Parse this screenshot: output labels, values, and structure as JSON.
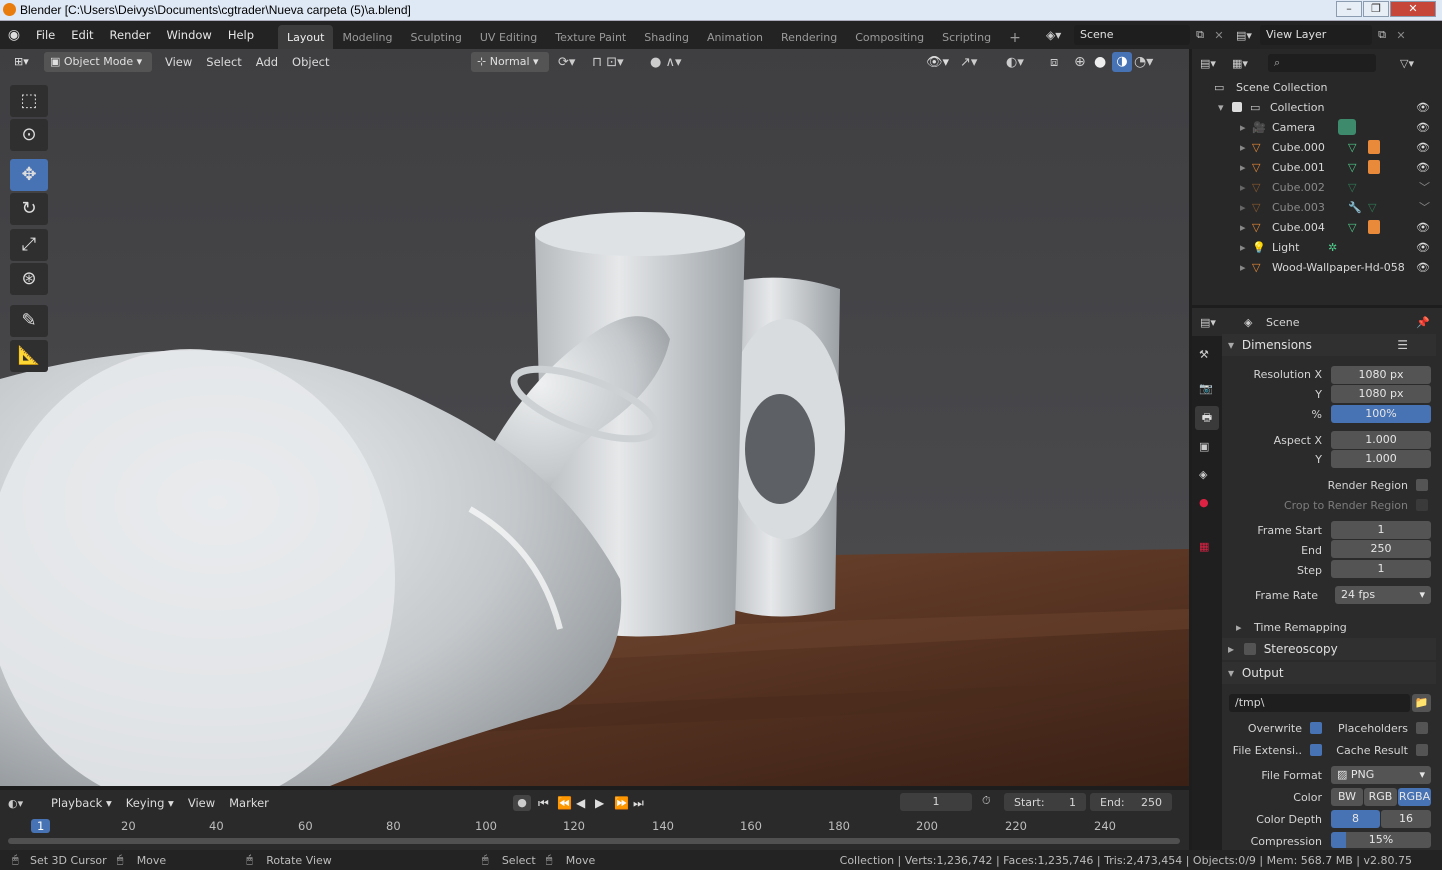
{
  "window": {
    "title": "Blender [C:\\Users\\Deivys\\Documents\\cgtrader\\Nueva carpeta (5)\\a.blend]"
  },
  "menu": {
    "items": [
      "File",
      "Edit",
      "Render",
      "Window",
      "Help"
    ]
  },
  "workspaces": [
    "Layout",
    "Modeling",
    "Sculpting",
    "UV Editing",
    "Texture Paint",
    "Shading",
    "Animation",
    "Rendering",
    "Compositing",
    "Scripting"
  ],
  "scene_selector": {
    "label": "Scene"
  },
  "view_layer": {
    "label": "View Layer"
  },
  "viewport_header": {
    "mode": "Object Mode",
    "menus": [
      "View",
      "Select",
      "Add",
      "Object"
    ],
    "orientation": "Normal"
  },
  "outliner": {
    "root": "Scene Collection",
    "collection": "Collection",
    "items": [
      {
        "name": "Camera",
        "dim": false
      },
      {
        "name": "Cube.000",
        "dim": false
      },
      {
        "name": "Cube.001",
        "dim": false
      },
      {
        "name": "Cube.002",
        "dim": true
      },
      {
        "name": "Cube.003",
        "dim": true
      },
      {
        "name": "Cube.004",
        "dim": false
      },
      {
        "name": "Light",
        "dim": false
      },
      {
        "name": "Wood-Wallpaper-Hd-058",
        "dim": false
      }
    ]
  },
  "properties": {
    "context": "Scene",
    "dimensions_title": "Dimensions",
    "resolution_x_label": "Resolution X",
    "resolution_x": "1080 px",
    "y_label": "Y",
    "resolution_y": "1080 px",
    "pct_label": "%",
    "resolution_pct": "100%",
    "aspect_x_label": "Aspect X",
    "aspect_x": "1.000",
    "aspect_y": "1.000",
    "render_region": "Render Region",
    "crop_region": "Crop to Render Region",
    "frame_start_label": "Frame Start",
    "frame_start": "1",
    "end_label": "End",
    "frame_end": "250",
    "step_label": "Step",
    "frame_step": "1",
    "frame_rate_label": "Frame Rate",
    "frame_rate": "24 fps",
    "time_remapping": "Time Remapping",
    "stereoscopy": "Stereoscopy",
    "output_title": "Output",
    "output_path": "/tmp\\",
    "overwrite": "Overwrite",
    "placeholders": "Placeholders",
    "file_ext": "File Extensi..",
    "cache_result": "Cache Result",
    "file_format_label": "File Format",
    "file_format": "PNG",
    "color_label": "Color",
    "color_modes": [
      "BW",
      "RGB",
      "RGBA"
    ],
    "color_depth_label": "Color Depth",
    "color_depths": [
      "8",
      "16"
    ],
    "compression_label": "Compression",
    "compression": "15%"
  },
  "timeline": {
    "menus": [
      "Playback",
      "Keying",
      "View",
      "Marker"
    ],
    "current_frame": "1",
    "start_label": "Start:",
    "start": "1",
    "end_label": "End:",
    "end": "250",
    "ticks": [
      "1",
      "20",
      "40",
      "60",
      "80",
      "100",
      "120",
      "140",
      "160",
      "180",
      "200",
      "220",
      "240"
    ]
  },
  "statusbar": {
    "set_cursor": "Set 3D Cursor",
    "move": "Move",
    "rotate": "Rotate View",
    "select": "Select",
    "move2": "Move",
    "stats": "Collection | Verts:1,236,742 | Faces:1,235,746 | Tris:2,473,454 | Objects:0/9 | Mem: 568.7 MB | v2.80.75"
  },
  "colors": {
    "accent": "#4772b3",
    "header": "#232323",
    "panel": "#2b2b2b"
  }
}
